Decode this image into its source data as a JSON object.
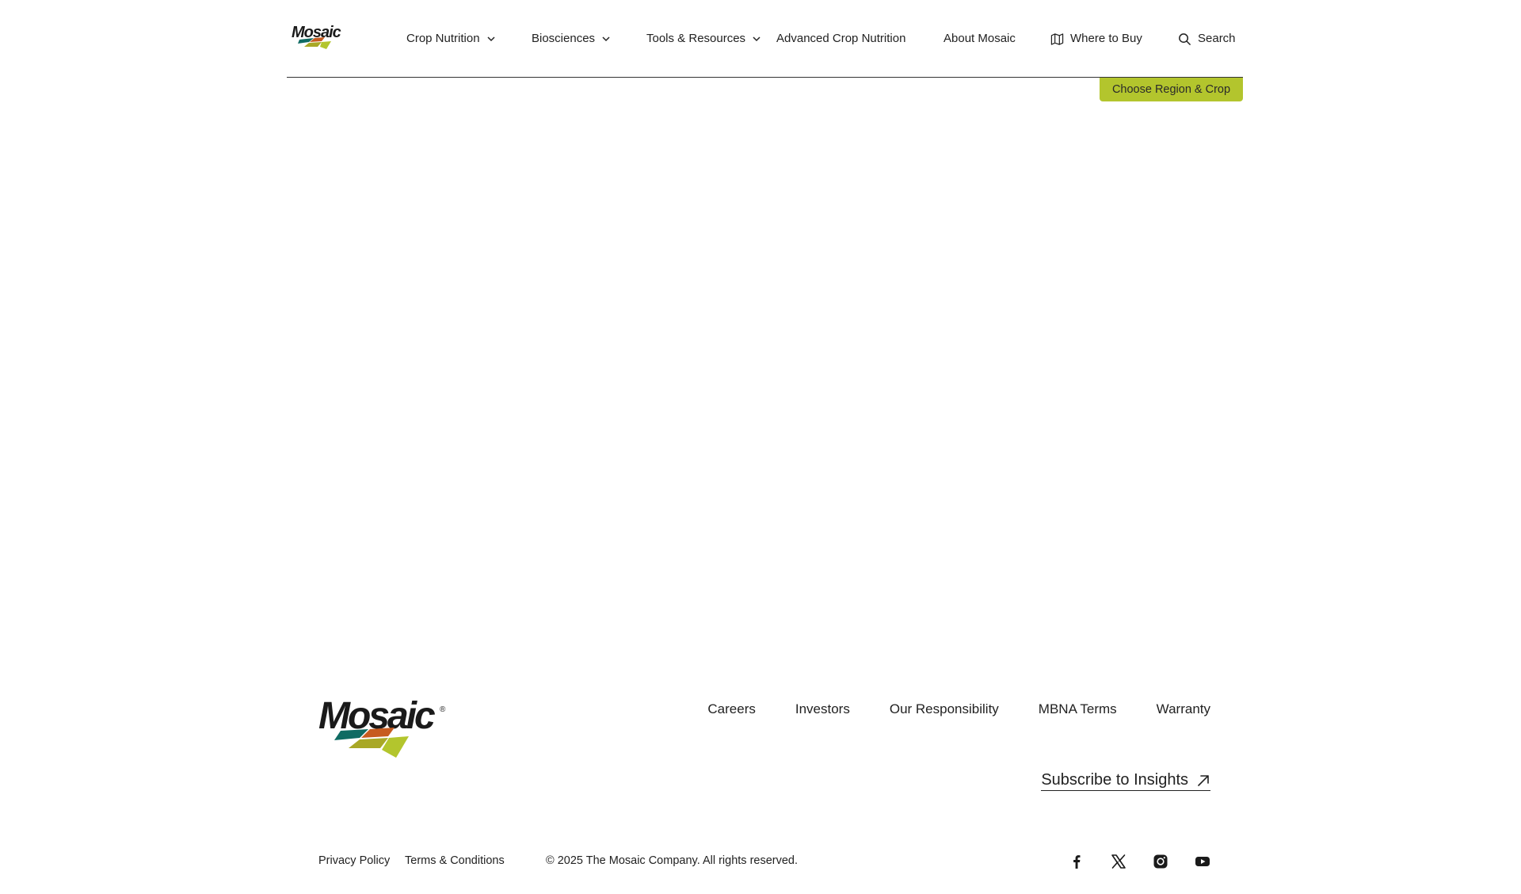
{
  "brand": {
    "name": "Mosaic",
    "registered": "®",
    "colors": {
      "teal": "#0f6b63",
      "orange": "#c75b1f",
      "olive": "#a9a826",
      "lime": "#b3c52d"
    }
  },
  "header": {
    "nav": {
      "crop_nutrition": "Crop Nutrition",
      "biosciences": "Biosciences",
      "tools_resources": "Tools & Resources",
      "advanced_crop_nutrition": "Advanced Crop Nutrition",
      "about_mosaic": "About Mosaic",
      "where_to_buy": "Where to Buy",
      "search": "Search"
    },
    "icons": {
      "dropdown": "chevron-down-icon",
      "where_to_buy": "map-icon",
      "search": "search-icon"
    },
    "region_button": "Choose Region & Crop"
  },
  "footer": {
    "links": [
      "Careers",
      "Investors",
      "Our Responsibility",
      "MBNA Terms",
      "Warranty"
    ],
    "subscribe": "Subscribe to Insights",
    "subscribe_icon": "arrow-up-right-icon",
    "legal": {
      "privacy": "Privacy Policy",
      "terms": "Terms & Conditions",
      "copyright": "© 2025 The Mosaic Company. All rights reserved."
    },
    "social_icons": [
      "facebook-icon",
      "x-icon",
      "instagram-icon",
      "youtube-icon"
    ]
  }
}
